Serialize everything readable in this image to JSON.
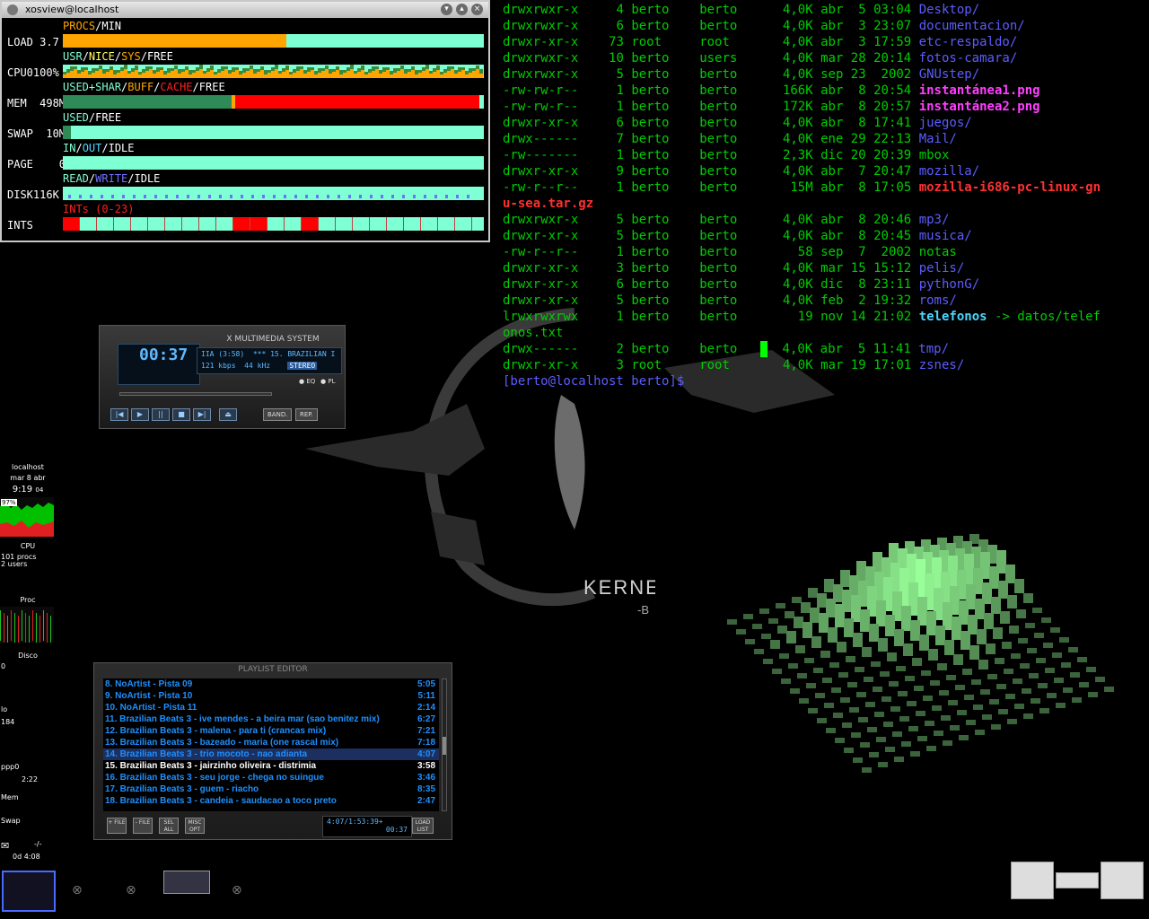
{
  "xosview": {
    "title": "xosview@localhost",
    "meters": [
      {
        "name": "LOAD 3.7",
        "legend": [
          {
            "t": "PROCS",
            "c": "#ffa500"
          },
          {
            "t": "/",
            "c": "#fff"
          },
          {
            "t": "MIN",
            "c": "#fff"
          }
        ],
        "fill": [
          {
            "c": "#ffa500",
            "p": 53
          }
        ]
      },
      {
        "name": "CPU0100%",
        "legend": [
          {
            "t": "USR",
            "c": "#7fffd4"
          },
          {
            "t": "/",
            "c": "#fff"
          },
          {
            "t": "NICE",
            "c": "#ffff66"
          },
          {
            "t": "/",
            "c": "#fff"
          },
          {
            "t": "SYS",
            "c": "#ffa500"
          },
          {
            "t": "/",
            "c": "#fff"
          },
          {
            "t": "FREE",
            "c": "#fff"
          }
        ],
        "fill": [
          {
            "c": "#3a8a3a",
            "p": 45
          },
          {
            "c": "#ffa500",
            "p": 55
          }
        ]
      },
      {
        "name": "MEM  498M",
        "legend": [
          {
            "t": "USED+SHAR",
            "c": "#7fffd4"
          },
          {
            "t": "/",
            "c": "#fff"
          },
          {
            "t": "BUFF",
            "c": "#ffa500"
          },
          {
            "t": "/",
            "c": "#fff"
          },
          {
            "t": "CACHE",
            "c": "#ff2020"
          },
          {
            "t": "/",
            "c": "#fff"
          },
          {
            "t": "FREE",
            "c": "#fff"
          }
        ],
        "fill": [
          {
            "c": "#2e8b57",
            "p": 40
          },
          {
            "c": "#ffa500",
            "p": 1
          },
          {
            "c": "#ff0000",
            "p": 58
          }
        ]
      },
      {
        "name": "SWAP  10M",
        "legend": [
          {
            "t": "USED",
            "c": "#7fffd4"
          },
          {
            "t": "/",
            "c": "#fff"
          },
          {
            "t": "FREE",
            "c": "#fff"
          }
        ],
        "fill": [
          {
            "c": "#2e8b57",
            "p": 2
          }
        ]
      },
      {
        "name": "PAGE    0",
        "legend": [
          {
            "t": "IN",
            "c": "#7fffd4"
          },
          {
            "t": "/",
            "c": "#fff"
          },
          {
            "t": "OUT",
            "c": "#4ad8ff"
          },
          {
            "t": "/",
            "c": "#fff"
          },
          {
            "t": "IDLE",
            "c": "#fff"
          }
        ],
        "fill": []
      },
      {
        "name": "DISK116K",
        "legend": [
          {
            "t": "READ",
            "c": "#7fffd4"
          },
          {
            "t": "/",
            "c": "#fff"
          },
          {
            "t": "WRITE",
            "c": "#7070ff"
          },
          {
            "t": "/",
            "c": "#fff"
          },
          {
            "t": "IDLE",
            "c": "#fff"
          }
        ],
        "fill": []
      },
      {
        "name": "INTS",
        "legend": [
          {
            "t": "INTs (0-23)",
            "c": "#ff2020"
          }
        ],
        "fill": []
      }
    ]
  },
  "terminal": {
    "lines": [
      {
        "perm": "drwxrwxr-x",
        "n": "4",
        "u": "berto",
        "g": "berto",
        "size": "4,0K",
        "date": "abr  5 03:04",
        "name": "Desktop",
        "suffix": "/",
        "kind": "dir"
      },
      {
        "perm": "drwxrwxr-x",
        "n": "6",
        "u": "berto",
        "g": "berto",
        "size": "4,0K",
        "date": "abr  3 23:07",
        "name": "documentacion",
        "suffix": "/",
        "kind": "dir"
      },
      {
        "perm": "drwxr-xr-x",
        "n": "73",
        "u": "root",
        "g": "root",
        "size": "4,0K",
        "date": "abr  3 17:59",
        "name": "etc-respaldo",
        "suffix": "/",
        "kind": "dir"
      },
      {
        "perm": "drwxrwxr-x",
        "n": "10",
        "u": "berto",
        "g": "users",
        "size": "4,0K",
        "date": "mar 28 20:14",
        "name": "fotos-camara",
        "suffix": "/",
        "kind": "dir"
      },
      {
        "perm": "drwxrwxr-x",
        "n": "5",
        "u": "berto",
        "g": "berto",
        "size": "4,0K",
        "date": "sep 23  2002",
        "name": "GNUstep",
        "suffix": "/",
        "kind": "dir"
      },
      {
        "perm": "-rw-rw-r--",
        "n": "1",
        "u": "berto",
        "g": "berto",
        "size": "166K",
        "date": "abr  8 20:54",
        "name": "instantánea1.png",
        "suffix": "",
        "kind": "img"
      },
      {
        "perm": "-rw-rw-r--",
        "n": "1",
        "u": "berto",
        "g": "berto",
        "size": "172K",
        "date": "abr  8 20:57",
        "name": "instantánea2.png",
        "suffix": "",
        "kind": "img"
      },
      {
        "perm": "drwxr-xr-x",
        "n": "6",
        "u": "berto",
        "g": "berto",
        "size": "4,0K",
        "date": "abr  8 17:41",
        "name": "juegos",
        "suffix": "/",
        "kind": "dir"
      },
      {
        "perm": "drwx------",
        "n": "7",
        "u": "berto",
        "g": "berto",
        "size": "4,0K",
        "date": "ene 29 22:13",
        "name": "Mail",
        "suffix": "/",
        "kind": "dir"
      },
      {
        "perm": "-rw-------",
        "n": "1",
        "u": "berto",
        "g": "berto",
        "size": "2,3K",
        "date": "dic 20 20:39",
        "name": "mbox",
        "suffix": "",
        "kind": "plain"
      },
      {
        "perm": "drwxr-xr-x",
        "n": "9",
        "u": "berto",
        "g": "berto",
        "size": "4,0K",
        "date": "abr  7 20:47",
        "name": "mozilla",
        "suffix": "/",
        "kind": "dir"
      },
      {
        "perm": "-rw-r--r--",
        "n": "1",
        "u": "berto",
        "g": "berto",
        "size": "15M",
        "date": "abr  8 17:05",
        "name": "mozilla-i686-pc-linux-gn",
        "suffix": "",
        "kind": "arc"
      },
      {
        "wrap": "u-sea.tar.gz",
        "kind": "arc"
      },
      {
        "perm": "drwxrwxr-x",
        "n": "5",
        "u": "berto",
        "g": "berto",
        "size": "4,0K",
        "date": "abr  8 20:46",
        "name": "mp3",
        "suffix": "/",
        "kind": "dir"
      },
      {
        "perm": "drwxr-xr-x",
        "n": "5",
        "u": "berto",
        "g": "berto",
        "size": "4,0K",
        "date": "abr  8 20:45",
        "name": "musica",
        "suffix": "/",
        "kind": "dir"
      },
      {
        "perm": "-rw-r--r--",
        "n": "1",
        "u": "berto",
        "g": "berto",
        "size": "58",
        "date": "sep  7  2002",
        "name": "notas",
        "suffix": "",
        "kind": "plain"
      },
      {
        "perm": "drwxr-xr-x",
        "n": "3",
        "u": "berto",
        "g": "berto",
        "size": "4,0K",
        "date": "mar 15 15:12",
        "name": "pelis",
        "suffix": "/",
        "kind": "dir"
      },
      {
        "perm": "drwxr-xr-x",
        "n": "6",
        "u": "berto",
        "g": "berto",
        "size": "4,0K",
        "date": "dic  8 23:11",
        "name": "pythonG",
        "suffix": "/",
        "kind": "dir"
      },
      {
        "perm": "drwxr-xr-x",
        "n": "5",
        "u": "berto",
        "g": "berto",
        "size": "4,0K",
        "date": "feb  2 19:32",
        "name": "roms",
        "suffix": "/",
        "kind": "dir"
      },
      {
        "perm": "lrwxrwxrwx",
        "n": "1",
        "u": "berto",
        "g": "berto",
        "size": "19",
        "date": "nov 14 21:02",
        "name": "telefonos",
        "suffix": " -> datos/telef",
        "kind": "lnk"
      },
      {
        "wrap": "onos.txt",
        "kind": "plain"
      },
      {
        "perm": "drwx------",
        "n": "2",
        "u": "berto",
        "g": "berto",
        "size": "4,0K",
        "date": "abr  5 11:41",
        "name": "tmp",
        "suffix": "/",
        "kind": "dir"
      },
      {
        "perm": "drwxr-xr-x",
        "n": "3",
        "u": "root",
        "g": "root",
        "size": "4,0K",
        "date": "mar 19 17:01",
        "name": "zsnes",
        "suffix": "/",
        "kind": "dir"
      }
    ],
    "prompt": "[berto@localhost berto]$"
  },
  "xmms": {
    "title": "X MULTIMEDIA SYSTEM",
    "time": "00:37",
    "track_num": "IIA (3:58)",
    "track_scroll": "*** 15. BRAZILIAN I",
    "kbps": "121 kbps",
    "khz": "44 kHz",
    "stereo": "STEREO",
    "eq": "EQ",
    "pl": "PL",
    "band": "BAND.",
    "rep": "REP.",
    "controls": [
      "|◀",
      "▶",
      "||",
      "■",
      "▶|",
      "⏏"
    ]
  },
  "gkrellm": {
    "host": "localhost",
    "date": "mar 8 abr",
    "time": "9:19",
    "secs": "04",
    "cpu_pct": "97%",
    "cpu_label": "CPU",
    "procs": "101 procs",
    "users": "2 users",
    "proc_label": "Proc",
    "disk_label": "Disco",
    "disk_val": "0",
    "lo_label": "lo",
    "lo_val": "184",
    "ppp_label": "ppp0",
    "ppp_time": "2:22",
    "mem_label": "Mem",
    "swap_label": "Swap",
    "mail": "-/-",
    "uptime": "0d 4:08"
  },
  "playlist": {
    "title": "PLAYLIST EDITOR",
    "rows": [
      {
        "t": "8. NoArtist - Pista 09",
        "d": "5:05"
      },
      {
        "t": "9. NoArtist - Pista 10",
        "d": "5:11"
      },
      {
        "t": "10. NoArtist - Pista 11",
        "d": "2:14"
      },
      {
        "t": "11. Brazilian Beats 3 - ive mendes - a beira mar (sao benitez mix)",
        "d": "6:27"
      },
      {
        "t": "12. Brazilian Beats 3 - malena - para ti (crancas mix)",
        "d": "7:21"
      },
      {
        "t": "13. Brazilian Beats 3 - bazeado - maria (one rascal mix)",
        "d": "7:18"
      },
      {
        "t": "14. Brazilian Beats 3 - trio mocoto - nao adianta",
        "d": "4:07"
      },
      {
        "t": "15. Brazilian Beats 3 - jairzinho oliveira - distrimia",
        "d": "3:58"
      },
      {
        "t": "16. Brazilian Beats 3 - seu jorge - chega no suingue",
        "d": "3:46"
      },
      {
        "t": "17. Brazilian Beats 3 - guem - riacho",
        "d": "8:35"
      },
      {
        "t": "18. Brazilian Beats 3 - candeia - saudacao a toco preto",
        "d": "2:47"
      }
    ],
    "selected_index": 6,
    "current_index": 7,
    "buttons": [
      "+ FILE",
      "- FILE",
      "SEL ALL",
      "MISC OPT"
    ],
    "load_list": "LOAD LIST",
    "total_time": "4:07/1:53:39+",
    "elapsed": "00:37"
  },
  "wallpaper": {
    "brand": "KERNEL",
    "tag": "-B"
  },
  "colors": {
    "terminal_green": "#00cd00",
    "dir_blue": "#5c5cff",
    "xosview_free": "#7fffd4"
  }
}
